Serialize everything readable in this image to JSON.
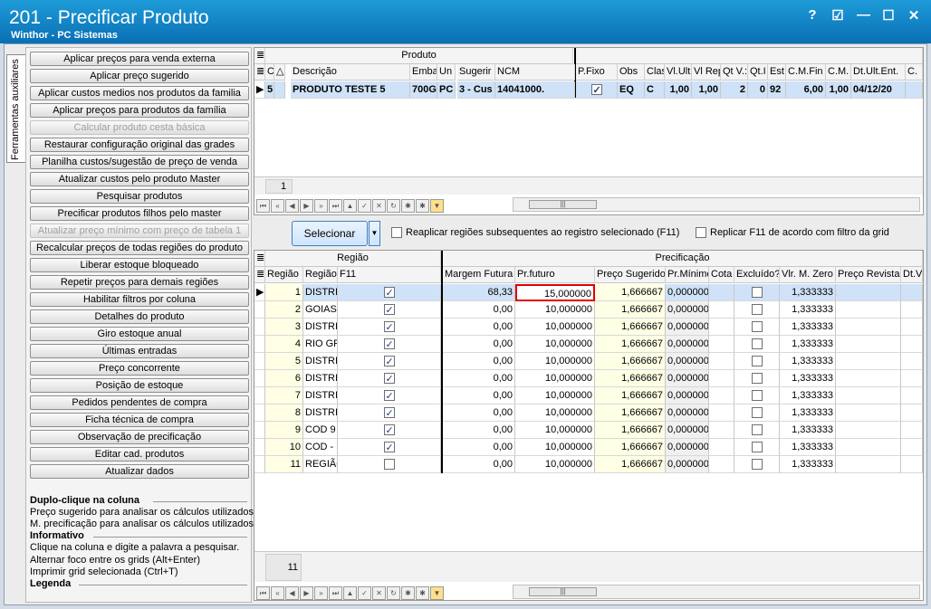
{
  "window": {
    "title": "201 - Precificar Produto",
    "subtitle": "Winthor - PC Sistemas",
    "controls": [
      "?",
      "☑",
      "—",
      "☐",
      "✕"
    ]
  },
  "side_tab": "Ferramentas auxiliares",
  "tool_buttons": [
    {
      "label": "Aplicar preços para venda externa",
      "enabled": true
    },
    {
      "label": "Aplicar preço sugerido",
      "enabled": true
    },
    {
      "label": "Aplicar custos medios nos produtos da familia",
      "enabled": true
    },
    {
      "label": "Aplicar preços para produtos da família",
      "enabled": true
    },
    {
      "label": "Calcular produto cesta básica",
      "enabled": false
    },
    {
      "label": "Restaurar configuração original das grades",
      "enabled": true
    },
    {
      "label": "Planilha custos/sugestão de preço de venda",
      "enabled": true
    },
    {
      "label": "Atualizar custos pelo produto Master",
      "enabled": true
    },
    {
      "label": "Pesquisar produtos",
      "enabled": true
    },
    {
      "label": "Precificar produtos filhos pelo master",
      "enabled": true
    },
    {
      "label": "Atualizar preço mínimo com preço de tabela 1",
      "enabled": false
    },
    {
      "label": "Recalcular preços de todas regiões do produto",
      "enabled": true
    },
    {
      "label": "Liberar estoque bloqueado",
      "enabled": true
    },
    {
      "label": "Repetir preços para demais regiões",
      "enabled": true
    },
    {
      "label": "Habilitar filtros por coluna",
      "enabled": true
    },
    {
      "label": "Detalhes do produto",
      "enabled": true
    },
    {
      "label": "Giro estoque anual",
      "enabled": true
    },
    {
      "label": "Últimas entradas",
      "enabled": true
    },
    {
      "label": "Preço concorrente",
      "enabled": true
    },
    {
      "label": "Posição de estoque",
      "enabled": true
    },
    {
      "label": "Pedidos pendentes de compra",
      "enabled": true
    },
    {
      "label": "Ficha técnica de compra",
      "enabled": true
    },
    {
      "label": "Observação de precificação",
      "enabled": true
    },
    {
      "label": "Editar cad. produtos",
      "enabled": true
    },
    {
      "label": "Atualizar dados",
      "enabled": true
    }
  ],
  "help": {
    "h1": "Duplo-clique na coluna",
    "l1": "Preço sugerido para analisar os cálculos utilizados.",
    "l2": "M. precificação para analisar os cálculos utilizados.",
    "h2": "Informativo",
    "l3": "Clique na coluna e digite a palavra a pesquisar.",
    "l4": "Alternar foco entre os grids (Alt+Enter)",
    "l5": "Imprimir grid selecionada (Ctrl+T)",
    "h3": "Legenda"
  },
  "product_grid": {
    "band": "Produto",
    "headers": [
      "C",
      "△",
      "Descrição",
      "Emba",
      "Un",
      "Sugerir",
      "NCM",
      "P.Fixo",
      "Obs",
      "Clas",
      "Vl.Ult",
      "Vl Rep",
      "Qt V.:",
      "Qt.I",
      "Est",
      "C.M.Fin",
      "C.M.",
      "Dt.Ult.Ent.",
      "C."
    ],
    "row": {
      "code": "5",
      "desc": "PRODUTO TESTE 5",
      "emba": "700G",
      "un": "PC",
      "sugerir": "3 - Cus",
      "ncm": "14041000.",
      "pfixo": true,
      "obs": "EQ",
      "clas": "C",
      "vlult": "1,00",
      "vlrep": "1,00",
      "qtv": "2",
      "qti": "0",
      "est": "92",
      "cmfin": "6,00",
      "cm": "1,00",
      "dtult": "04/12/20",
      "c": ""
    },
    "count": "1"
  },
  "action_bar": {
    "select_button": "Selecionar",
    "opt1": "Reaplicar regiões subsequentes ao registro selecionado (F11)",
    "opt2": "Replicar F11 de acordo com filtro da grid"
  },
  "region_grid": {
    "band_left": "Região",
    "band_right": "Precificação",
    "headers": [
      "Região",
      "Região",
      "F11",
      "Margem Futura",
      "Pr.futuro",
      "Preço Sugerido",
      "Pr.Mínimo",
      "Cota",
      "Excluído?",
      "Vlr. M. Zero",
      "Preço Revista",
      "Dt.V"
    ],
    "rows": [
      {
        "num": "1",
        "name": "DISTRI",
        "f11": true,
        "margem": "68,33",
        "prfut": "15,000000",
        "sug": "1,666667",
        "prmin": "0,000000",
        "excl": false,
        "mzero": "1,333333"
      },
      {
        "num": "2",
        "name": "GOIAS",
        "f11": true,
        "margem": "0,00",
        "prfut": "10,000000",
        "sug": "1,666667",
        "prmin": "0,000000",
        "excl": false,
        "mzero": "1,333333"
      },
      {
        "num": "3",
        "name": "DISTRI",
        "f11": true,
        "margem": "0,00",
        "prfut": "10,000000",
        "sug": "1,666667",
        "prmin": "0,000000",
        "excl": false,
        "mzero": "1,333333"
      },
      {
        "num": "4",
        "name": "RIO GR",
        "f11": true,
        "margem": "0,00",
        "prfut": "10,000000",
        "sug": "1,666667",
        "prmin": "0,000000",
        "excl": false,
        "mzero": "1,333333"
      },
      {
        "num": "5",
        "name": "DISTRI",
        "f11": true,
        "margem": "0,00",
        "prfut": "10,000000",
        "sug": "1,666667",
        "prmin": "0,000000",
        "excl": false,
        "mzero": "1,333333"
      },
      {
        "num": "6",
        "name": "DISTRI",
        "f11": true,
        "margem": "0,00",
        "prfut": "10,000000",
        "sug": "1,666667",
        "prmin": "0,000000",
        "excl": false,
        "mzero": "1,333333"
      },
      {
        "num": "7",
        "name": "DISTRI",
        "f11": true,
        "margem": "0,00",
        "prfut": "10,000000",
        "sug": "1,666667",
        "prmin": "0,000000",
        "excl": false,
        "mzero": "1,333333"
      },
      {
        "num": "8",
        "name": "DISTRI",
        "f11": true,
        "margem": "0,00",
        "prfut": "10,000000",
        "sug": "1,666667",
        "prmin": "0,000000",
        "excl": false,
        "mzero": "1,333333"
      },
      {
        "num": "9",
        "name": "COD 9",
        "f11": true,
        "margem": "0,00",
        "prfut": "10,000000",
        "sug": "1,666667",
        "prmin": "0,000000",
        "excl": false,
        "mzero": "1,333333"
      },
      {
        "num": "10",
        "name": "COD - :",
        "f11": true,
        "margem": "0,00",
        "prfut": "10,000000",
        "sug": "1,666667",
        "prmin": "0,000000",
        "excl": false,
        "mzero": "1,333333"
      },
      {
        "num": "11",
        "name": "REGIÃO",
        "f11": false,
        "margem": "0,00",
        "prfut": "10,000000",
        "sug": "1,666667",
        "prmin": "0,000000",
        "excl": false,
        "mzero": "1,333333"
      }
    ],
    "count": "11"
  },
  "nav_icons": [
    "first-icon",
    "prior-page-icon",
    "prior-icon",
    "next-icon",
    "next-page-icon",
    "last-icon",
    "insert-icon",
    "post-icon",
    "cancel-icon",
    "refresh-icon",
    "asterisk-icon",
    "asterisk-dim-icon",
    "filter-icon"
  ],
  "colors": {
    "title_bg": "#0a6fb4",
    "selected_row": "#cfe2f7",
    "yellow_col": "#ffffe6",
    "focus_cell_border": "#e00000"
  }
}
